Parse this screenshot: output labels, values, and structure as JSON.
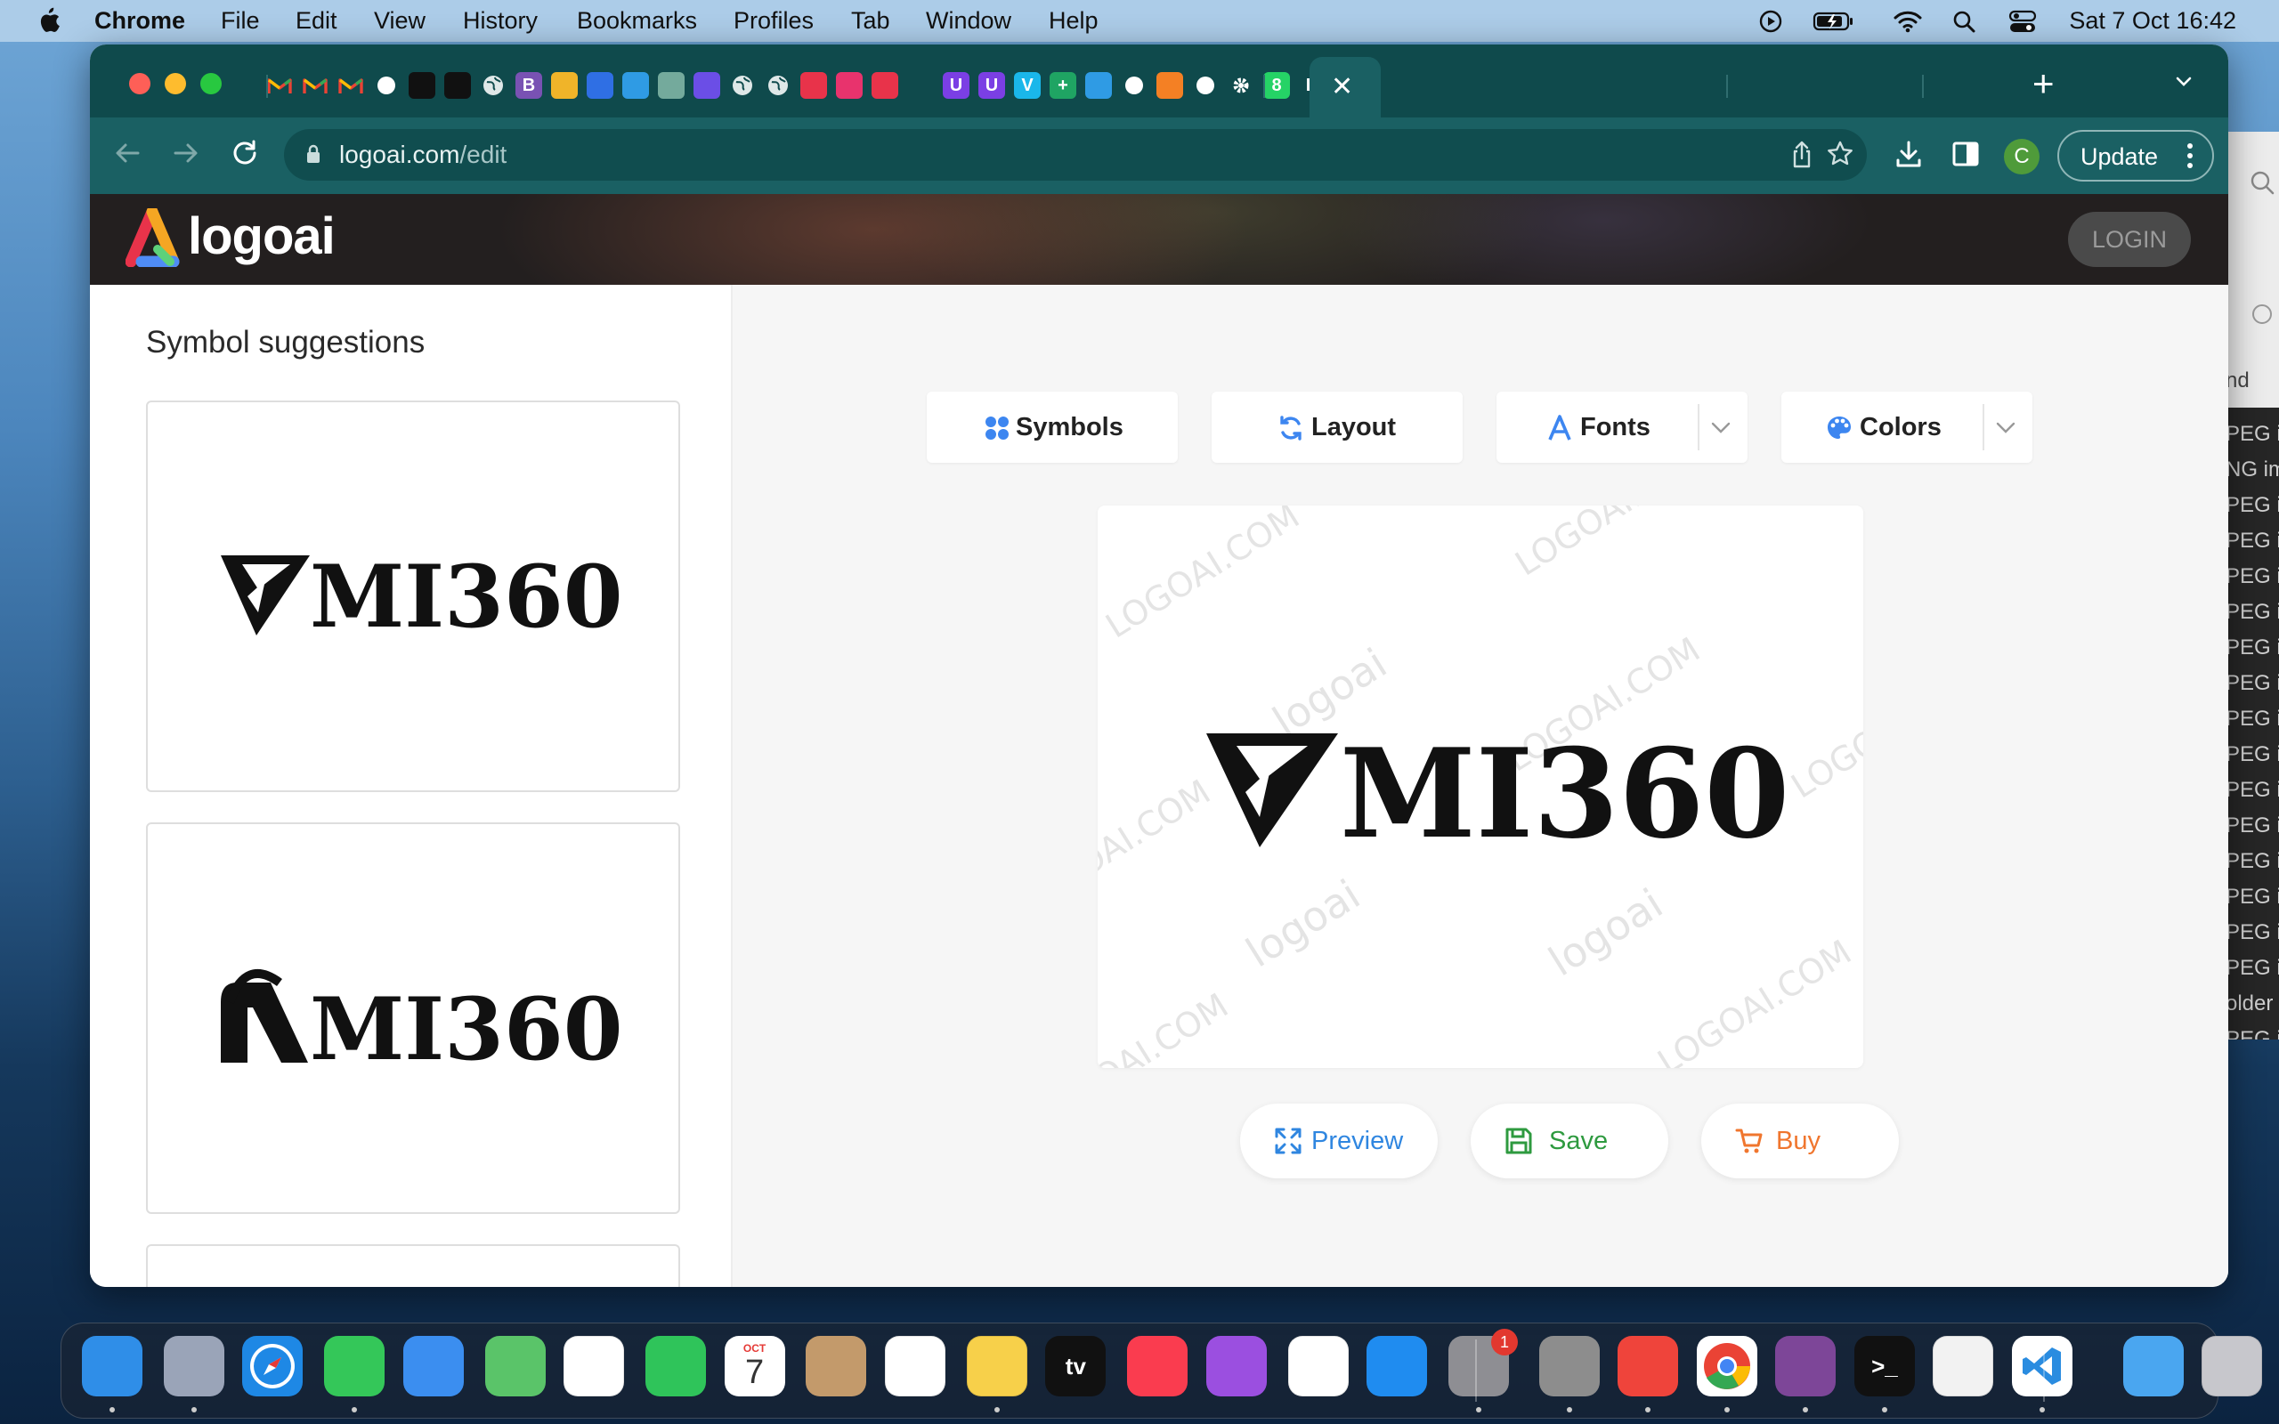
{
  "menubar": {
    "app_name": "Chrome",
    "items": [
      "File",
      "Edit",
      "View",
      "History",
      "Bookmarks",
      "Profiles",
      "Tab",
      "Window",
      "Help"
    ],
    "datetime": "Sat 7 Oct  16:42"
  },
  "browser": {
    "url_host": "logoai.com",
    "url_path": "/edit",
    "update_label": "Update",
    "profile_initial": "C",
    "tabs": [
      {
        "icon": "gmail-icon",
        "color": "#ffffff"
      },
      {
        "icon": "gmail-icon",
        "color": "#ffffff"
      },
      {
        "icon": "gmail-icon",
        "color": "#ffffff"
      },
      {
        "icon": "red-circle-icon",
        "color": "#ffffff"
      },
      {
        "icon": "triangle-ruler-icon",
        "color": "#000000"
      },
      {
        "icon": "triangle-ruler-icon",
        "color": "#000000"
      },
      {
        "icon": "globe-icon",
        "color": "#ffffff"
      },
      {
        "icon": "bootstrap-icon",
        "color": "#7952b3",
        "text": "B"
      },
      {
        "icon": "sun-icon",
        "color": "#f0b429"
      },
      {
        "icon": "mail-icon",
        "color": "#2f6fe4"
      },
      {
        "icon": "chat-bubble-icon",
        "color": "#2f9be4"
      },
      {
        "icon": "chatgpt-icon",
        "color": "#74aa9c"
      },
      {
        "icon": "h-logo-icon",
        "color": "#6b4ee6"
      },
      {
        "icon": "globe-icon",
        "color": "#ffffff"
      },
      {
        "icon": "globe-icon",
        "color": "#ffffff"
      },
      {
        "icon": "paper-plane-icon",
        "color": "#e8334a"
      },
      {
        "icon": "asterisk-icon",
        "color": "#e8336d"
      },
      {
        "icon": "logoai-tab-icon",
        "color": "#e8334a"
      },
      {
        "icon": "u-logo-icon",
        "color": "#7b3fe4",
        "text": "U"
      },
      {
        "icon": "u-logo-icon",
        "color": "#7b3fe4",
        "text": "U"
      },
      {
        "icon": "vimeo-icon",
        "color": "#1ab7ea",
        "text": "V"
      },
      {
        "icon": "sheets-plus-icon",
        "color": "#1fa463",
        "text": "+"
      },
      {
        "icon": "edge-like-icon",
        "color": "#2f9be4"
      },
      {
        "icon": "github-icon",
        "color": "#ffffff"
      },
      {
        "icon": "stack-icon",
        "color": "#f48024"
      },
      {
        "icon": "brand-square-icon",
        "color": "#ffffff"
      },
      {
        "icon": "gear-icon",
        "color": "#ffffff"
      },
      {
        "icon": "whatsapp-icon",
        "color": "#25d366",
        "text": "8"
      },
      {
        "icon": "b-logo-icon",
        "color": "#ffffff",
        "text": "B"
      }
    ]
  },
  "site": {
    "logo_text": "logoai",
    "login_label": "LOGIN",
    "panel_title": "Symbol suggestions",
    "brand_name": "MI360",
    "watermark_text": "logoai",
    "watermark_url": "LOGOAI.COM",
    "tools": {
      "symbols": "Symbols",
      "layout": "Layout",
      "fonts": "Fonts",
      "colors": "Colors"
    },
    "actions": {
      "preview": "Preview",
      "save": "Save",
      "buy": "Buy"
    }
  },
  "background_window": {
    "rows": [
      "PEG i",
      "NG im",
      "PEG i",
      "PEG i",
      "PEG i",
      "PEG i",
      "PEG i",
      "PEG i",
      "PEG i",
      "PEG i",
      "PEG i",
      "PEG i",
      "PEG i",
      "PEG i",
      "PEG i",
      "PEG i",
      "older",
      "PEG i"
    ],
    "partial_label": "nd"
  },
  "dock": {
    "apps": [
      {
        "name": "finder",
        "color": "#2f8ee8"
      },
      {
        "name": "launchpad",
        "color": "#9aa4b8"
      },
      {
        "name": "safari",
        "color": "#1e88e5"
      },
      {
        "name": "messages",
        "color": "#34c759"
      },
      {
        "name": "mail",
        "color": "#3b8ef0"
      },
      {
        "name": "maps",
        "color": "#5ac469"
      },
      {
        "name": "photos",
        "color": "#ffffff"
      },
      {
        "name": "facetime",
        "color": "#2fc45a"
      },
      {
        "name": "calendar",
        "color": "#ffffff",
        "month": "OCT",
        "day": "7"
      },
      {
        "name": "contacts",
        "color": "#c39a6b"
      },
      {
        "name": "reminders",
        "color": "#ffffff"
      },
      {
        "name": "notes",
        "color": "#f7d04a"
      },
      {
        "name": "apple-tv",
        "color": "#111111",
        "text": "tv"
      },
      {
        "name": "music",
        "color": "#fa3c4f"
      },
      {
        "name": "podcasts",
        "color": "#9b4fe0"
      },
      {
        "name": "news",
        "color": "#ffffff"
      },
      {
        "name": "app-store",
        "color": "#1f8cf0"
      },
      {
        "name": "system-settings",
        "color": "#8e8e93",
        "badge": "1"
      },
      {
        "name": "tableplus",
        "color": "#8d8d8d"
      },
      {
        "name": "anydesk",
        "color": "#ef443b"
      },
      {
        "name": "chrome",
        "color": "#ffffff"
      },
      {
        "name": "tor-browser",
        "color": "#7d4698"
      },
      {
        "name": "terminal",
        "color": "#111111",
        "text": ">_"
      },
      {
        "name": "textedit",
        "color": "#f2f2f2"
      },
      {
        "name": "vscode",
        "color": "#ffffff"
      },
      {
        "name": "downloads-folder",
        "color": "#4aa6f0"
      },
      {
        "name": "trash",
        "color": "#c7c7cc"
      }
    ]
  }
}
